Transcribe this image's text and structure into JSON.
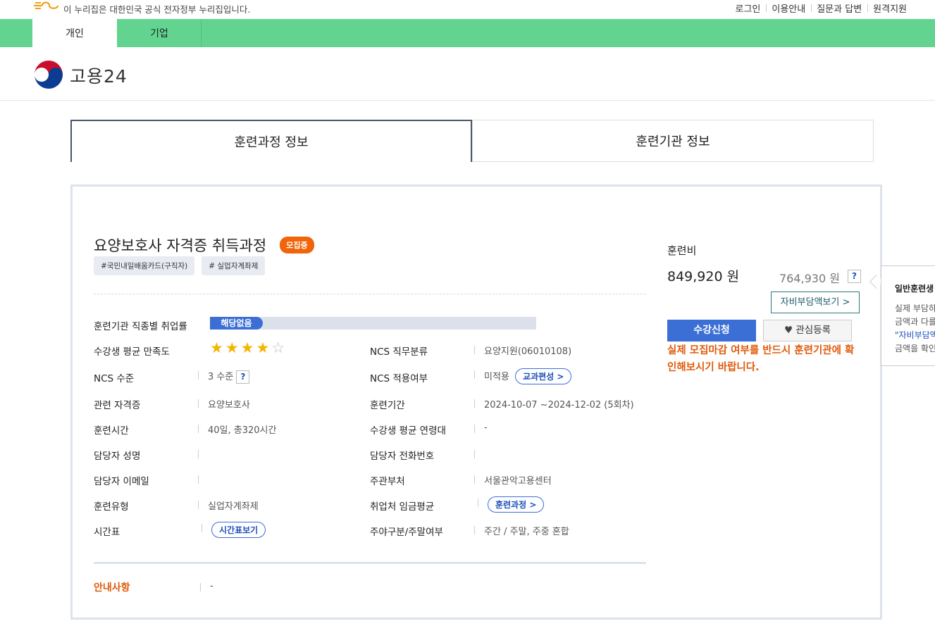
{
  "gov_bar": {
    "notice": "이 누리집은 대한민국 공식 전자정부 누리집입니다.",
    "links": [
      "로그인",
      "이용안내",
      "질문과 답변",
      "원격지원"
    ]
  },
  "gnb": {
    "tabs": [
      "개인",
      "기업"
    ]
  },
  "site": {
    "name": "고용24"
  },
  "main_tabs": [
    "훈련과정 정보",
    "훈련기관 정보"
  ],
  "course": {
    "title": "요양보호사 자격증 취득과정",
    "status_badge": "모집중",
    "tags": [
      "#국민내일배움카드(구직자)",
      "# 실업자계좌제"
    ]
  },
  "info": {
    "employment_rate_label": "훈련기관 직종별 취업률",
    "employment_rate_value": "해당없음",
    "satisfaction_label": "수강생 평균 만족도",
    "satisfaction_stars": 4,
    "satisfaction_max": 5,
    "ncs_job_label": "NCS 직무분류",
    "ncs_job_value": "요양지원(06010108)",
    "ncs_level_label": "NCS 수준",
    "ncs_level_value": "3 수준",
    "ncs_apply_label": "NCS 적용여부",
    "ncs_apply_value": "미적용",
    "curriculum_btn": "교과편성 >",
    "cert_label": "관련 자격증",
    "cert_value": "요양보호사",
    "period_label": "훈련기간",
    "period_value": "2024-10-07 ~2024-12-02 (5회차)",
    "hours_label": "훈련시간",
    "hours_value": "40일, 총320시간",
    "age_label": "수강생 평균 연령대",
    "age_value": "-",
    "manager_name_label": "담당자 성명",
    "manager_phone_label": "담당자 전화번호",
    "manager_email_label": "담당자 이메일",
    "ministry_label": "주관부처",
    "ministry_value": "서울관악고용센터",
    "type_label": "훈련유형",
    "type_value": "실업자계좌제",
    "wage_label": "취업처 임금평균",
    "wage_btn": "훈련과정 >",
    "timetable_label": "시간표",
    "timetable_btn": "시간표보기",
    "daynight_label": "주야구분/주말여부",
    "daynight_value": "주간 / 주말, 주중 혼합",
    "notice_label": "안내사항",
    "notice_value": "-"
  },
  "fee": {
    "label": "훈련비",
    "amount": "849,920 원",
    "self_amount": "764,930 원",
    "help": "?",
    "self_btn": "자비부담액보기 >",
    "apply_btn": "수강신청",
    "wish_btn": "관심등록",
    "warning": "실제 모집마감 여부를 반드시 훈련기관에 확인해보시기 바랍니다."
  },
  "side_tip": {
    "title": "일반훈련생",
    "line1": "실제 부담하",
    "line2": "금액과 다를",
    "line3": "\"자비부담액",
    "line4": "금액을 확인"
  },
  "colors": {
    "gnb": "#62d490",
    "accent": "#3b6fd6",
    "badge": "#f0640a",
    "warn": "#e05a0a"
  }
}
